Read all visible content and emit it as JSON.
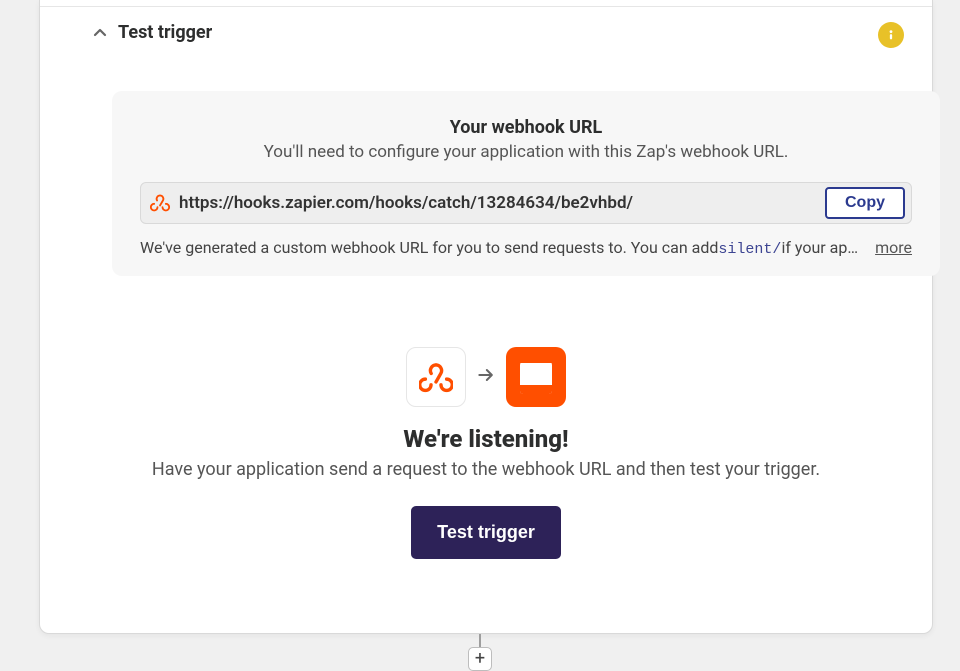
{
  "section": {
    "title": "Test trigger"
  },
  "webhook": {
    "title": "Your webhook URL",
    "subtitle": "You'll need to configure your application with this Zap's webhook URL.",
    "url": "https://hooks.zapier.com/hooks/catch/13284634/be2vhbd/",
    "copy_label": "Copy",
    "desc_pre": "We've generated a custom webhook URL for you to send requests to. You can add ",
    "desc_code": "silent/",
    "desc_post": " if your application prefers no response body.",
    "more_label": "more"
  },
  "listening": {
    "title": "We're listening!",
    "subtitle": "Have your application send a request to the webhook URL and then test your trigger.",
    "button_label": "Test trigger"
  },
  "add_node_label": "+"
}
